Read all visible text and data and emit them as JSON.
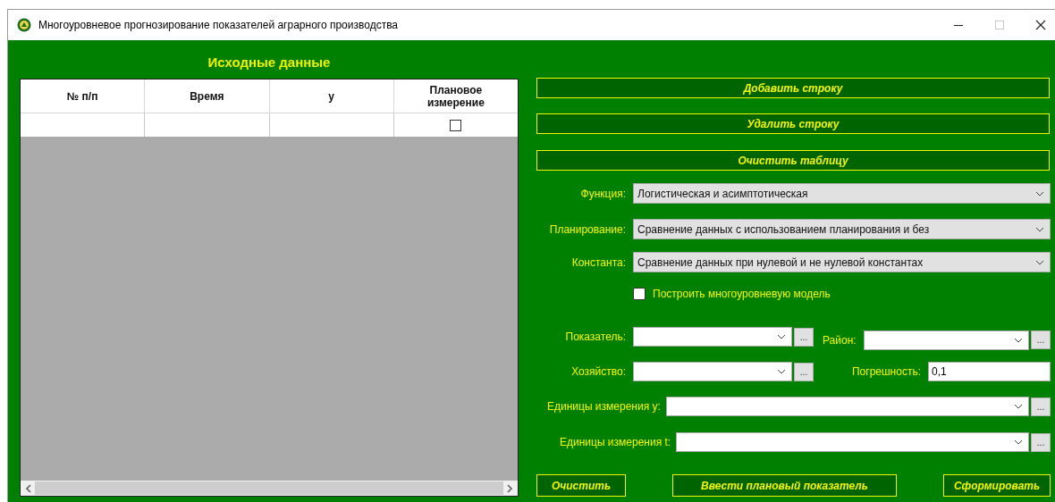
{
  "window": {
    "title": "Многоуровневое прогнозирование показателей аграрного производства"
  },
  "source_data": {
    "title": "Исходные данные",
    "columns": [
      "№ п/п",
      "Время",
      "y",
      "Плановое измерение"
    ],
    "rows": [
      {
        "planned": false
      }
    ]
  },
  "action_buttons": [
    "Добавить строку",
    "Удалить строку",
    "Очистить таблицу"
  ],
  "selects": [
    {
      "label": "Функция:",
      "value": "Логистическая и асимптотическая"
    },
    {
      "label": "Планирование:",
      "value": "Сравнение данных с использованием планирования и без"
    },
    {
      "label": "Константа:",
      "value": "Сравнение данных при нулевой и не нулевой константах"
    }
  ],
  "multilevel_model": {
    "label": "Построить многоуровневую модель",
    "checked": false
  },
  "indicator": {
    "label": "Показатель:",
    "button": "..."
  },
  "district": {
    "label": "Район:",
    "button": "..."
  },
  "farm": {
    "label": "Хозяйство:",
    "button": "..."
  },
  "error": {
    "label": "Погрешность:",
    "value": "0,1"
  },
  "units_y": {
    "label": "Единицы измерения y:",
    "button": "..."
  },
  "units_t": {
    "label": "Единицы измерения t:",
    "button": "..."
  },
  "bottom_buttons": [
    "Очистить",
    "Ввести плановый показатель",
    "Сформировать"
  ]
}
